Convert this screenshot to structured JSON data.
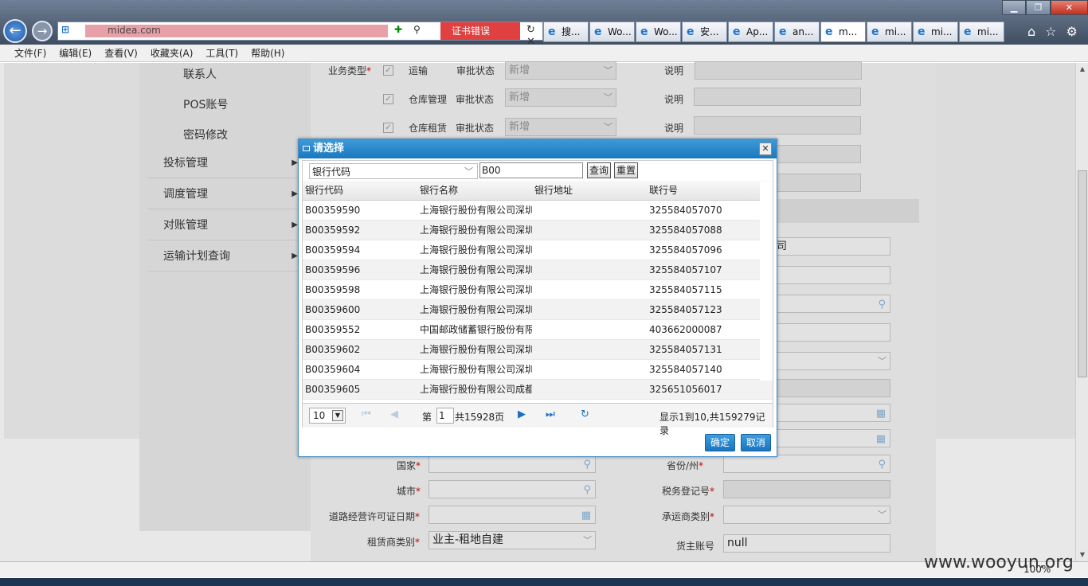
{
  "browser": {
    "url_domain": "midea.com",
    "cert_error": "证书错误",
    "tabs": [
      "搜...",
      "Wo...",
      "Wo...",
      "安...",
      "Ap...",
      "an...",
      "m...",
      "mi...",
      "mi...",
      "mi..."
    ],
    "menu": [
      "文件(F)",
      "编辑(E)",
      "查看(V)",
      "收藏夹(A)",
      "工具(T)",
      "帮助(H)"
    ],
    "zoom": "100%"
  },
  "sidebar": {
    "sub_items": [
      "联系人",
      "POS账号",
      "密码修改"
    ],
    "items": [
      "投标管理",
      "调度管理",
      "对账管理",
      "运输计划查询"
    ]
  },
  "form": {
    "business_type_label": "业务类型",
    "rows": [
      {
        "type": "运输",
        "status_label": "审批状态",
        "status": "新增",
        "note_label": "说明"
      },
      {
        "type": "仓库管理",
        "status_label": "审批状态",
        "status": "新增",
        "note_label": "说明"
      },
      {
        "type": "仓库租赁",
        "status_label": "审批状态",
        "status": "新增",
        "note_label": "说明"
      }
    ],
    "company_suffix": "司",
    "country_label": "国家",
    "province_label": "省份/州",
    "city_label": "城市",
    "tax_label": "税务登记号",
    "road_label": "道路经营许可证日期",
    "carrier_label": "承运商类别",
    "lessor_label": "租赁商类别",
    "lessor_value": "业主-租地自建",
    "shipper_label": "货主账号",
    "shipper_value": "null"
  },
  "dialog": {
    "title": "请选择",
    "filter_field": "银行代码",
    "query_value": "B00",
    "search_label": "查询",
    "reset_label": "重置",
    "columns": [
      "银行代码",
      "银行名称",
      "银行地址",
      "联行号"
    ],
    "rows": [
      {
        "code": "B00359590",
        "name": "上海银行股份有限公司深圳",
        "addr": "",
        "no": "325584057070"
      },
      {
        "code": "B00359592",
        "name": "上海银行股份有限公司深圳",
        "addr": "",
        "no": "325584057088"
      },
      {
        "code": "B00359594",
        "name": "上海银行股份有限公司深圳",
        "addr": "",
        "no": "325584057096"
      },
      {
        "code": "B00359596",
        "name": "上海银行股份有限公司深圳",
        "addr": "",
        "no": "325584057107"
      },
      {
        "code": "B00359598",
        "name": "上海银行股份有限公司深圳",
        "addr": "",
        "no": "325584057115"
      },
      {
        "code": "B00359600",
        "name": "上海银行股份有限公司深圳",
        "addr": "",
        "no": "325584057123"
      },
      {
        "code": "B00359552",
        "name": "中国邮政储蓄银行股份有限",
        "addr": "",
        "no": "403662000087"
      },
      {
        "code": "B00359602",
        "name": "上海银行股份有限公司深圳",
        "addr": "",
        "no": "325584057131"
      },
      {
        "code": "B00359604",
        "name": "上海银行股份有限公司深圳",
        "addr": "",
        "no": "325584057140"
      },
      {
        "code": "B00359605",
        "name": "上海银行股份有限公司成都",
        "addr": "",
        "no": "325651056017"
      }
    ],
    "page_size": "10",
    "page_prefix": "第",
    "page_num": "1",
    "page_total": "共15928页",
    "summary": "显示1到10,共159279记录",
    "ok_label": "确定",
    "cancel_label": "取消"
  },
  "watermark": "www.wooyun.org"
}
